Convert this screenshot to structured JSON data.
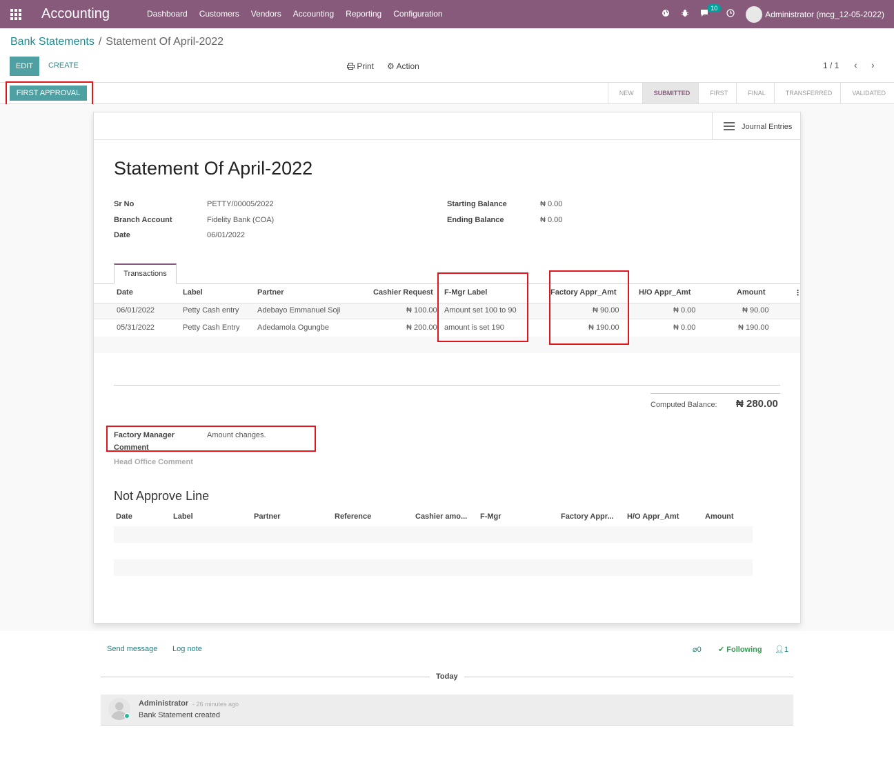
{
  "app": {
    "title": "Accounting",
    "menu": [
      "Dashboard",
      "Customers",
      "Vendors",
      "Accounting",
      "Reporting",
      "Configuration"
    ],
    "chat_count": "10",
    "user": "Administrator (mcg_12-05-2022)"
  },
  "breadcrumb": {
    "parent": "Bank Statements",
    "separator": "/",
    "current": "Statement Of April-2022"
  },
  "controls": {
    "edit": "EDIT",
    "create": "CREATE",
    "print": "Print",
    "action": "Action",
    "pager": "1 / 1"
  },
  "header": {
    "approve_button": "FIRST APPROVAL",
    "stages": [
      "NEW",
      "SUBMITTED",
      "FIRST",
      "FINAL",
      "TRANSFERRED",
      "VALIDATED"
    ],
    "active_stage": "SUBMITTED"
  },
  "button_box": {
    "journal_entries": "Journal Entries"
  },
  "record": {
    "title": "Statement Of April-2022",
    "sr_no_label": "Sr No",
    "sr_no": "PETTY/00005/2022",
    "branch_label": "Branch Account",
    "branch": "Fidelity Bank (COA)",
    "date_label": "Date",
    "date": "06/01/2022",
    "start_label": "Starting Balance",
    "start": "₦ 0.00",
    "end_label": "Ending Balance",
    "end": "₦ 0.00"
  },
  "tabs": {
    "transactions": "Transactions"
  },
  "transactions": {
    "headers": [
      "Date",
      "Label",
      "Partner",
      "Cashier Request",
      "F-Mgr Label",
      "Factory Appr_Amt",
      "H/O Appr_Amt",
      "Amount"
    ],
    "rows": [
      [
        "06/01/2022",
        "Petty Cash entry",
        "Adebayo Emmanuel Soji",
        "₦ 100.00",
        "Amount set 100 to 90",
        "₦ 90.00",
        "₦ 0.00",
        "₦ 90.00"
      ],
      [
        "05/31/2022",
        "Petty Cash Entry",
        "Adedamola Ogungbe",
        "₦ 200.00",
        "amount is set 190",
        "₦ 190.00",
        "₦ 0.00",
        "₦ 190.00"
      ]
    ]
  },
  "totals": {
    "computed_label": "Computed Balance:",
    "computed_value": "₦ 280.00"
  },
  "comments": {
    "factory_label_1": "Factory Manager",
    "factory_label_2": "Comment",
    "factory_value": "Amount changes.",
    "ho_label": "Head Office Comment"
  },
  "not_approve": {
    "title": "Not Approve Line",
    "headers": [
      "Date",
      "Label",
      "Partner",
      "Reference",
      "Cashier amo...",
      "F-Mgr",
      "Factory Appr...",
      "H/O Appr_Amt",
      "Amount"
    ]
  },
  "chatter": {
    "send_message": "Send message",
    "log_note": "Log note",
    "attachments": "0",
    "following": "Following",
    "followers": "1",
    "today": "Today",
    "message": {
      "author": "Administrator",
      "time": "- 26 minutes ago",
      "body": "Bank Statement created"
    }
  }
}
